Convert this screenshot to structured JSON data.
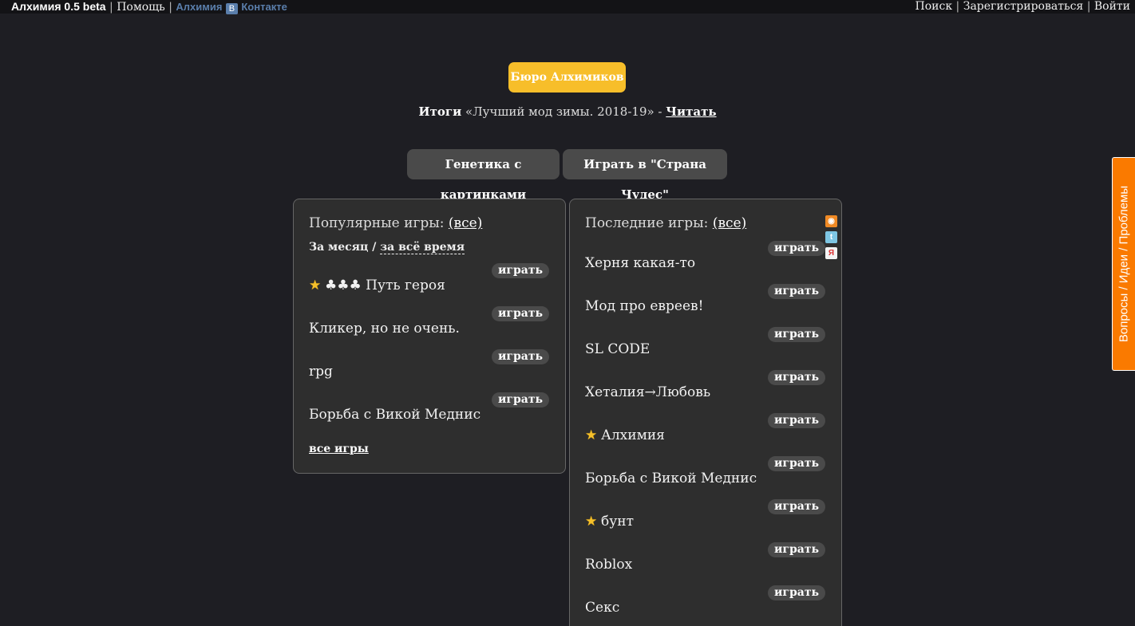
{
  "topbar": {
    "brand": "Алхимия 0.5 beta",
    "sep": "|",
    "help": "Помощь",
    "vk_prefix": "Алхимия",
    "vk_logo": "В",
    "vk_suffix": "Контакте",
    "search": "Поиск",
    "register": "Зарегистрироваться",
    "login": "Войти"
  },
  "bureau_button": "Бюро Алхимиков",
  "results": {
    "bold": "Итоги",
    "text": "«Лучший мод зимы. 2018-19» - ",
    "link": "Читать"
  },
  "buttons": {
    "genetics": "Генетика с картинками",
    "play_wonderland": "Играть в \"Страна Чудес\""
  },
  "popular": {
    "title": "Популярные игры: ",
    "all_link": "(все)",
    "period_month": "За месяц",
    "period_sep": " / ",
    "period_all_time": "за всё время",
    "play_label": "играть",
    "games": [
      {
        "name": "♣♣♣ Путь героя",
        "star": true
      },
      {
        "name": "Кликер, но не очень.",
        "star": false
      },
      {
        "name": "rpg",
        "star": false
      },
      {
        "name": "Борьба с Викой Меднис",
        "star": false
      }
    ],
    "all_games": "все игры"
  },
  "latest": {
    "title": "Последние игры: ",
    "all_link": "(все)",
    "play_label": "играть",
    "games": [
      {
        "name": "Херня какая-то",
        "star": false
      },
      {
        "name": "Мод про евреев!",
        "star": false
      },
      {
        "name": "SL CODE",
        "star": false
      },
      {
        "name": "Хеталия→Любовь",
        "star": false
      },
      {
        "name": "Алхимия",
        "star": true
      },
      {
        "name": "Борьба с Викой Меднис",
        "star": false
      },
      {
        "name": "бунт",
        "star": true
      },
      {
        "name": "Roblox",
        "star": false
      },
      {
        "name": "Секс",
        "star": false
      }
    ]
  },
  "feeds": {
    "rss": "rss-icon",
    "twitter": "twitter-icon",
    "yandex": "yandex-icon"
  },
  "side_tab": "Вопросы / Идеи / Проблемы",
  "colors": {
    "background": "#1e1e23",
    "accent_yellow": "#f7be2a",
    "side_tab_orange": "#fa7a00",
    "button_gray": "#4a4a4a"
  }
}
